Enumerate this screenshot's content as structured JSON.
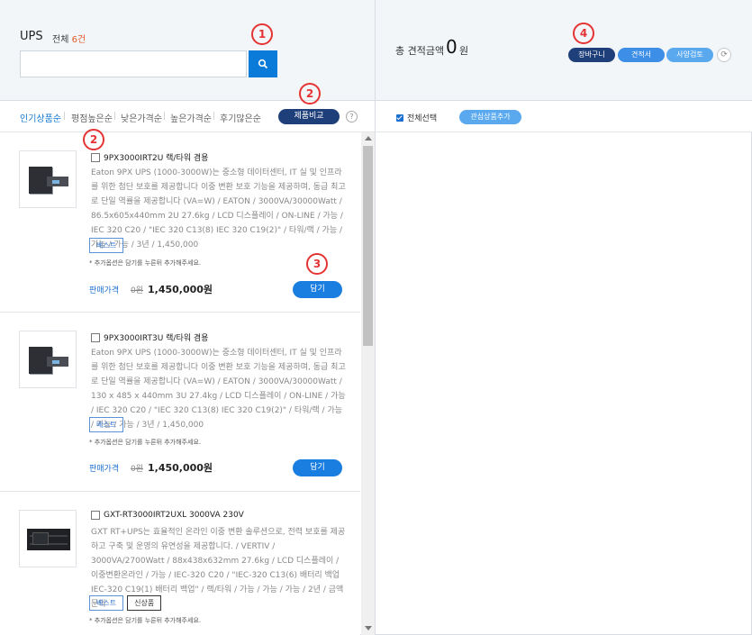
{
  "left_panel": {
    "title": "UPS",
    "count_prefix": "전체",
    "count_num": "6건",
    "search_value": "",
    "sort_tabs": [
      "인기상품순",
      "평점높은순",
      "낮은가격순",
      "높은가격순",
      "후기많은순"
    ],
    "compare_label": "제품비교",
    "help": "?"
  },
  "products": [
    {
      "name": "9PX3000IRT2U 랙/타워 겸용",
      "desc": "Eaton 9PX UPS (1000-3000W)는 중소형 데이터센터, IT 실 및 인프라를 위한 첨단 보호를 제공합니다 이중 변환 보호 기능을 제공하며, 동급 최고로 단일 역률을 제공합니다 (VA=W) / EATON / 3000VA/30000Watt / 86.5x605x440mm 2U 27.6kg / LCD 디스플레이 / ON-LINE / 가능 / IEC 320 C20 / \"IEC 320 C13(8) IEC 320 C19(2)\" / 타워/랙 / 가능 / 가능 / 가능 / 3년 / 1,450,000",
      "badges": [
        "베스트"
      ],
      "note": "* 추가옵션은 담기를 누른뒤 추가해주세요.",
      "price_label": "판매가격",
      "price_old": "0원",
      "price": "1,450,000원",
      "add_label": "담기"
    },
    {
      "name": "9PX3000IRT3U 랙/타워 겸용",
      "desc": "Eaton 9PX UPS (1000-3000W)는 중소형 데이터센터, IT 실 및 인프라를 위한 첨단 보호를 제공합니다 이중 변환 보호 기능을 제공하며, 동급 최고로 단일 역률을 제공합니다 (VA=W) / EATON / 3000VA/30000Watt / 130 x 485 x 440mm 3U 27.4kg / LCD 디스플레이 / ON-LINE / 가능 / IEC 320 C20 / \"IEC 320 C13(8) IEC 320 C19(2)\" / 타워/랙 / 가능 / 가능 / 가능 / 3년 / 1,450,000",
      "badges": [
        "베스트"
      ],
      "note": "* 추가옵션은 담기를 누른뒤 추가해주세요.",
      "price_label": "판매가격",
      "price_old": "0원",
      "price": "1,450,000원",
      "add_label": "담기"
    },
    {
      "name": "GXT-RT3000IRT2UXL 3000VA 230V",
      "desc": "GXT RT+UPS는 효율적인 온라인 이중 변환 솔루션으로, 전력 보호를 제공하고 구축 및 운영의 유연성을 제공합니다. / VERTIV / 3000VA/2700Watt / 88x438x632mm 27.6kg / LCD 디스플레이 / 이중변환온라인 / 가능 / IEC-320 C20 / \"IEC-320 C13(6) 배터리 백업 IEC-320 C19(1) 배터리 백업\" / 랙/타워 / 가능 / 가능 / 가능 / 2년 / 금액문의",
      "badges": [
        "베스트",
        "신상품"
      ],
      "note": "* 추가옵션은 담기를 누른뒤 추가해주세요."
    }
  ],
  "right_panel": {
    "total_label": "총 견적금액",
    "total_value": "0",
    "total_unit": "원",
    "buttons": [
      "장바구니",
      "견적서",
      "사양검토"
    ],
    "select_all": "전체선택",
    "add_fav": "관심상품추가"
  },
  "callouts": [
    "1",
    "2",
    "2",
    "3",
    "4"
  ],
  "colors": {
    "primary": "#1a7de0",
    "navy": "#1f3f7a",
    "callout": "#e53333"
  }
}
